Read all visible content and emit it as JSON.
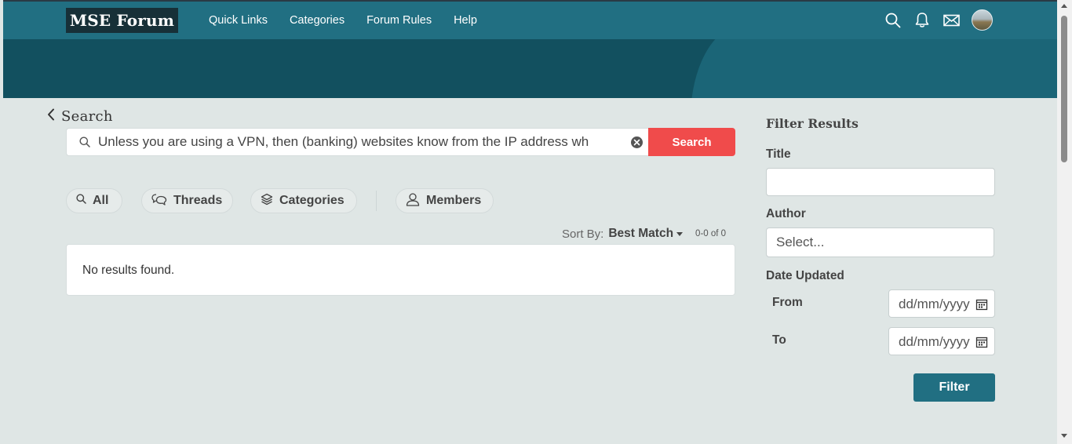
{
  "header": {
    "logo": "MSE Forum",
    "nav": [
      {
        "label": "Quick Links"
      },
      {
        "label": "Categories"
      },
      {
        "label": "Forum Rules"
      },
      {
        "label": "Help"
      }
    ],
    "icons": [
      "search-icon",
      "bell-icon",
      "mail-icon",
      "avatar"
    ]
  },
  "search": {
    "back_title": "Search",
    "query": "Unless you are using a VPN, then (banking) websites know from the IP address wh",
    "button_label": "Search"
  },
  "tabs": [
    {
      "label": "All",
      "icon": "search-icon"
    },
    {
      "label": "Threads",
      "icon": "chat-bubbles-icon"
    },
    {
      "label": "Categories",
      "icon": "layers-icon"
    },
    {
      "label": "Members",
      "icon": "person-icon"
    }
  ],
  "sort": {
    "label": "Sort By:",
    "value": "Best Match",
    "count": "0-0 of 0"
  },
  "results": {
    "message": "No results found."
  },
  "filter": {
    "title": "Filter Results",
    "title_label": "Title",
    "title_value": "",
    "author_label": "Author",
    "author_placeholder": "Select...",
    "date_label": "Date Updated",
    "from_label": "From",
    "from_placeholder": "dd/mm/yyyy",
    "to_label": "To",
    "to_placeholder": "dd/mm/yyyy",
    "button_label": "Filter"
  },
  "colors": {
    "header": "#216f82",
    "banner": "#12505f",
    "search_button": "#f04b4b",
    "filter_button": "#216f82",
    "background": "#dfe6e5"
  }
}
